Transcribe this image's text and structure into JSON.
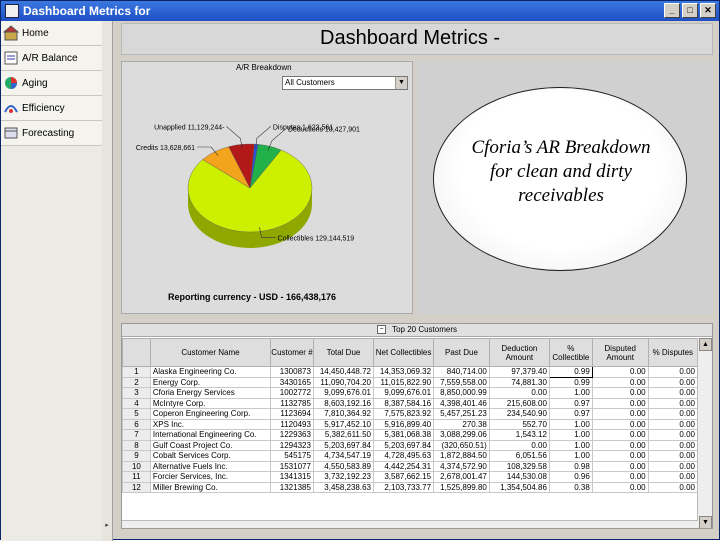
{
  "window": {
    "title": "Dashboard Metrics for",
    "btn_min": "_",
    "btn_max": "□",
    "btn_close": "✕"
  },
  "sidebar": {
    "items": [
      {
        "label": "Home",
        "icon": "home-icon"
      },
      {
        "label": "A/R Balance",
        "icon": "balance-icon"
      },
      {
        "label": "Aging",
        "icon": "aging-pie-icon"
      },
      {
        "label": "Efficiency",
        "icon": "efficiency-icon"
      },
      {
        "label": "Forecasting",
        "icon": "forecast-icon"
      }
    ]
  },
  "header": {
    "title": "Dashboard Metrics -"
  },
  "ar_panel": {
    "title": "A/R Breakdown",
    "selected_filter": "All Customers",
    "reporting": "Reporting currency - USD - 166,438,176"
  },
  "chart_data": {
    "type": "pie",
    "title": "A/R Breakdown",
    "slices": [
      {
        "label": "Disputes",
        "value": 1623561,
        "text": "Disputes 1,623,561",
        "color": "#2b4fd8"
      },
      {
        "label": "Deductions",
        "value": 10427901,
        "text": "Deductions 10,427,901",
        "color": "#22b04a"
      },
      {
        "label": "Collectibles",
        "value": 129144519,
        "text": "Collectibles 129,144,519",
        "color": "#ccf000"
      },
      {
        "label": "Credits",
        "value": 13628661,
        "text": "Credits 13,628,661",
        "color": "#f3a31c"
      },
      {
        "label": "Unapplied",
        "value": 11129244,
        "text": "Unapplied 11,129,244-",
        "color": "#b21818"
      }
    ]
  },
  "callout": {
    "text": "Cforia’s AR Breakdown\nfor clean and dirty\nreceivables"
  },
  "grid": {
    "title": "Top 20 Customers",
    "columns": [
      "Customer Name",
      "Customer #",
      "Total Due",
      "Net Collectibles",
      "Past Due",
      "Deduction Amount",
      "% Collectible",
      "Disputed Amount",
      "% Disputes"
    ],
    "rows": [
      [
        "1",
        "Alaska Engineering Co.",
        "1300873",
        "14,450,448.72",
        "14,353,069.32",
        "840,714.00",
        "97,379.40",
        "0.99",
        "0.00",
        "0.00"
      ],
      [
        "2",
        "Energy Corp.",
        "3430165",
        "11,090,704.20",
        "11,015,822.90",
        "7,559,558.00",
        "74,881.30",
        "0.99",
        "0.00",
        "0.00"
      ],
      [
        "3",
        "Cforia Energy Services",
        "1002772",
        "9,099,676.01",
        "9,099,676.01",
        "8,850,000.99",
        "0.00",
        "1.00",
        "0.00",
        "0.00"
      ],
      [
        "4",
        "McIntyre Corp.",
        "1132785",
        "8,603,192.16",
        "8,387,584.16",
        "4,398,401.46",
        "215,608.00",
        "0.97",
        "0.00",
        "0.00"
      ],
      [
        "5",
        "Coperon Engineering Corp.",
        "1123694",
        "7,810,364.92",
        "7,575,823.92",
        "5,457,251.23",
        "234,540.90",
        "0.97",
        "0.00",
        "0.00"
      ],
      [
        "6",
        "XPS Inc.",
        "1120493",
        "5,917,452.10",
        "5,916,899.40",
        "270.38",
        "552.70",
        "1.00",
        "0.00",
        "0.00"
      ],
      [
        "7",
        "International Engineering Co.",
        "1229363",
        "5,382,611.50",
        "5,381,068.38",
        "3,088,299.06",
        "1,543.12",
        "1.00",
        "0.00",
        "0.00"
      ],
      [
        "8",
        "Gulf Coast Project Co.",
        "1294323",
        "5,203,697.84",
        "5,203,697.84",
        "(320,650.51)",
        "0.00",
        "1.00",
        "0.00",
        "0.00"
      ],
      [
        "9",
        "Cobalt Services Corp.",
        "545175",
        "4,734,547.19",
        "4,728,495.63",
        "1,872,884.50",
        "6,051.56",
        "1.00",
        "0.00",
        "0.00"
      ],
      [
        "10",
        "Alternative Fuels Inc.",
        "1531077",
        "4,550,583.89",
        "4,442,254.31",
        "4,374,572.90",
        "108,329.58",
        "0.98",
        "0.00",
        "0.00"
      ],
      [
        "11",
        "Forcier Services, Inc.",
        "1341315",
        "3,732,192.23",
        "3,587,662.15",
        "2,678,001.47",
        "144,530.08",
        "0.96",
        "0.00",
        "0.00"
      ],
      [
        "12",
        "Miller Brewing Co.",
        "1321385",
        "3,458,238.63",
        "2,103,733.77",
        "1,525,899.80",
        "1,354,504.86",
        "0.38",
        "0.00",
        "0.00"
      ]
    ]
  }
}
